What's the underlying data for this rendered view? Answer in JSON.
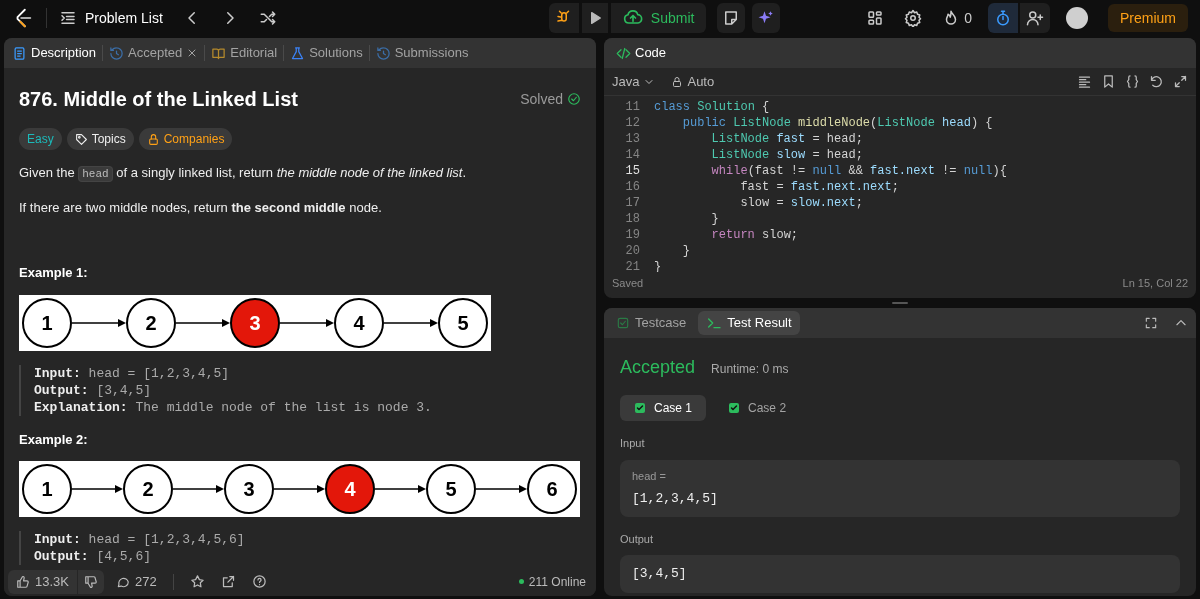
{
  "topbar": {
    "title": "Problem List",
    "streak": "0",
    "premium": "Premium",
    "submit": "Submit",
    "timer_active": true
  },
  "tabs": [
    {
      "label": "Description",
      "selected": true,
      "kind": "doc",
      "closable": false
    },
    {
      "label": "Accepted",
      "selected": false,
      "kind": "history",
      "closable": true
    },
    {
      "label": "Editorial",
      "selected": false,
      "kind": "book",
      "closable": false
    },
    {
      "label": "Solutions",
      "selected": false,
      "kind": "flask",
      "closable": false
    },
    {
      "label": "Submissions",
      "selected": false,
      "kind": "history",
      "closable": false
    }
  ],
  "problem": {
    "title": "876. Middle of the Linked List",
    "status": "Solved",
    "difficulty": "Easy",
    "topics": "Topics",
    "companies": "Companies",
    "paragraphs": [
      {
        "before": "Given the ",
        "code": "head",
        "after": " of a singly linked list, return *the middle node of the linked list*."
      },
      {
        "before": "If there are two middle nodes, return **the second middle** node."
      }
    ],
    "examples": [
      {
        "title": "Example 1:",
        "nodes": [
          {
            "label": "1",
            "highlighted": false
          },
          {
            "label": "2",
            "highlighted": false
          },
          {
            "label": "3",
            "highlighted": true
          },
          {
            "label": "4",
            "highlighted": false
          },
          {
            "label": "5",
            "highlighted": false
          }
        ],
        "lines": [
          {
            "key": "Input:",
            "value": "head = [1,2,3,4,5]"
          },
          {
            "key": "Output:",
            "value": "[3,4,5]"
          },
          {
            "key": "Explanation:",
            "value": "The middle node of the list is node 3."
          }
        ]
      },
      {
        "title": "Example 2:",
        "nodes": [
          {
            "label": "1",
            "highlighted": false
          },
          {
            "label": "2",
            "highlighted": false
          },
          {
            "label": "3",
            "highlighted": false
          },
          {
            "label": "4",
            "highlighted": true
          },
          {
            "label": "5",
            "highlighted": false
          },
          {
            "label": "6",
            "highlighted": false
          }
        ],
        "lines": [
          {
            "key": "Input:",
            "value": "head = [1,2,3,4,5,6]"
          },
          {
            "key": "Output:",
            "value": "[4,5,6]"
          }
        ]
      }
    ]
  },
  "footer": {
    "likes": "13.3K",
    "comments": "272",
    "online": "211 Online"
  },
  "code": {
    "title": "Code",
    "language": "Java",
    "mode": "Auto",
    "status": "Saved",
    "cursor": "Ln 15, Col 22",
    "lines": [
      {
        "num": "11",
        "current": false,
        "tokens": [
          {
            "text": "class ",
            "kind": "kw"
          },
          {
            "text": "Solution",
            "kind": "type"
          },
          {
            "text": " {",
            "kind": "p"
          }
        ]
      },
      {
        "num": "12",
        "current": false,
        "tokens": [
          {
            "text": "    public ",
            "kind": "kw"
          },
          {
            "text": "ListNode ",
            "kind": "type"
          },
          {
            "text": "middleNode",
            "kind": "fn"
          },
          {
            "text": "(",
            "kind": "p"
          },
          {
            "text": "ListNode ",
            "kind": "type"
          },
          {
            "text": "head",
            "kind": "var"
          },
          {
            "text": ") {",
            "kind": "p"
          }
        ]
      },
      {
        "num": "13",
        "current": false,
        "tokens": [
          {
            "text": "        ListNode ",
            "kind": "type"
          },
          {
            "text": "fast",
            "kind": "var"
          },
          {
            "text": " = head;",
            "kind": "p"
          }
        ]
      },
      {
        "num": "14",
        "current": false,
        "tokens": [
          {
            "text": "        ListNode ",
            "kind": "type"
          },
          {
            "text": "slow",
            "kind": "var"
          },
          {
            "text": " = head;",
            "kind": "p"
          }
        ]
      },
      {
        "num": "15",
        "current": true,
        "tokens": [
          {
            "text": "        while",
            "kind": "ctrl"
          },
          {
            "text": "(fast != ",
            "kind": "p"
          },
          {
            "text": "null",
            "kind": "kw"
          },
          {
            "text": " && ",
            "kind": "p"
          },
          {
            "text": "fast.next",
            "kind": "var"
          },
          {
            "text": " != ",
            "kind": "p"
          },
          {
            "text": "null",
            "kind": "kw"
          },
          {
            "text": "){",
            "kind": "p"
          }
        ]
      },
      {
        "num": "16",
        "current": false,
        "tokens": [
          {
            "text": "            fast = ",
            "kind": "p"
          },
          {
            "text": "fast.next.next",
            "kind": "var"
          },
          {
            "text": ";",
            "kind": "p"
          }
        ]
      },
      {
        "num": "17",
        "current": false,
        "tokens": [
          {
            "text": "            slow = ",
            "kind": "p"
          },
          {
            "text": "slow.next",
            "kind": "var"
          },
          {
            "text": ";",
            "kind": "p"
          }
        ]
      },
      {
        "num": "18",
        "current": false,
        "tokens": [
          {
            "text": "        }",
            "kind": "p"
          }
        ]
      },
      {
        "num": "19",
        "current": false,
        "tokens": [
          {
            "text": "        return",
            "kind": "ctrl"
          },
          {
            "text": " slow;",
            "kind": "p"
          }
        ]
      },
      {
        "num": "20",
        "current": false,
        "tokens": [
          {
            "text": "    }",
            "kind": "p"
          }
        ]
      },
      {
        "num": "21",
        "current": false,
        "tokens": [
          {
            "text": "}",
            "kind": "p"
          }
        ]
      }
    ]
  },
  "test": {
    "tabs": [
      {
        "label": "Testcase",
        "selected": false,
        "kind": "check"
      },
      {
        "label": "Test Result",
        "selected": true,
        "kind": "terminal"
      }
    ],
    "verdict": "Accepted",
    "runtime": "Runtime: 0 ms",
    "cases": [
      {
        "label": "Case 1",
        "selected": true,
        "passed": true
      },
      {
        "label": "Case 2",
        "selected": false,
        "passed": true
      }
    ],
    "input_label": "Input",
    "input_name": "head =",
    "input_value": "[1,2,3,4,5]",
    "output_label": "Output",
    "output_value": "[3,4,5]"
  }
}
